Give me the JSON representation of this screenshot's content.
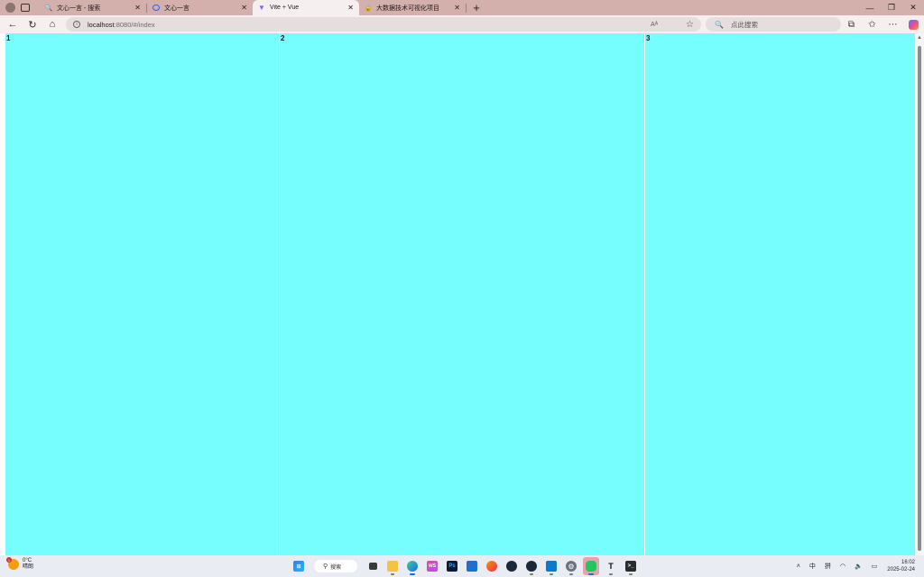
{
  "browser": {
    "tabs": [
      {
        "label": "文心一言 - 搜索",
        "icon": "search-icon",
        "active": false
      },
      {
        "label": "文心一言",
        "icon": "wenxin-icon",
        "active": false
      },
      {
        "label": "Vite + Vue",
        "icon": "vite-icon",
        "active": true
      },
      {
        "label": "大数据技术可视化项目",
        "icon": "lock-icon",
        "active": false
      }
    ],
    "new_tab": "+",
    "window_controls": {
      "minimize": "—",
      "restore": "❐",
      "close": "✕"
    },
    "nav": {
      "back": "←",
      "refresh": "↻",
      "home": "⌂"
    },
    "address": {
      "host": "localhost",
      "path": ":8080/#/index",
      "reader": "𝖠ᴬ",
      "favorite": "☆"
    },
    "search_placeholder": "点此搜索",
    "toolbar_icons": [
      "extensions-icon",
      "favorites-icon",
      "more-icon",
      "copilot-icon"
    ]
  },
  "page": {
    "panels": [
      {
        "label": "1",
        "color": "#76fefe"
      },
      {
        "label": "2",
        "color": "#76fefe"
      },
      {
        "label": "3",
        "color": "#76fefe"
      }
    ]
  },
  "taskbar": {
    "weather": {
      "temp": "0°C",
      "condition": "晴朗",
      "badge": "1"
    },
    "search_label": "搜索",
    "apps": [
      "windows-start-icon",
      "file-explorer-icon",
      "edge-icon",
      "webstorm-icon",
      "photoshop-icon",
      "store-icon",
      "firefox-icon",
      "steam-icon",
      "steam-icon",
      "vscode-icon",
      "settings-icon",
      "wechat-icon",
      "typora-icon",
      "terminal-icon"
    ],
    "tray": {
      "ime_lang": "中",
      "ime_mode": "拼",
      "wifi": "wifi-icon",
      "volume": "volume-icon",
      "battery": "battery-icon"
    },
    "clock": {
      "time": "16:02",
      "date": "2025-02-24"
    }
  }
}
